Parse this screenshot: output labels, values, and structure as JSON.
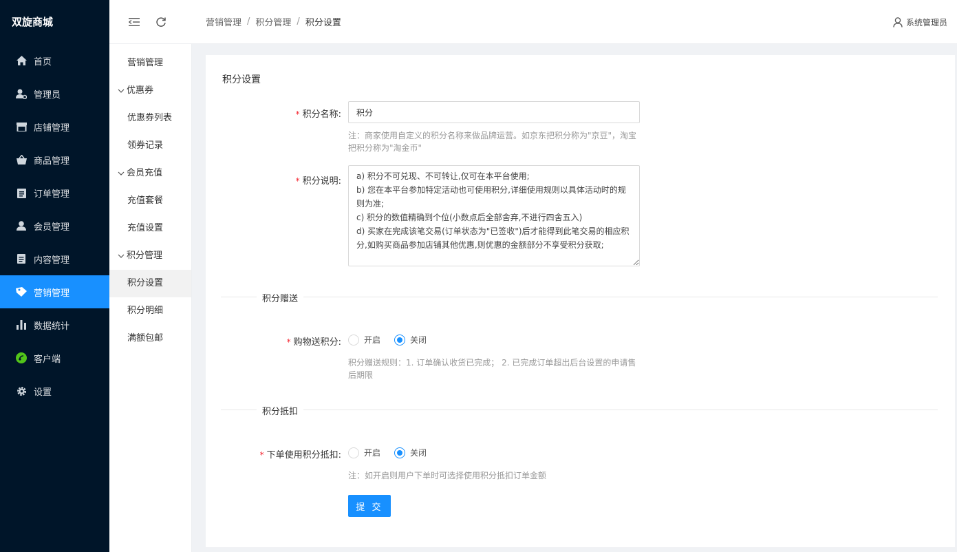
{
  "brand": "双旋商城",
  "sidebar": {
    "items": [
      {
        "label": "首页",
        "icon": "home-icon"
      },
      {
        "label": "管理员",
        "icon": "admin-user-icon"
      },
      {
        "label": "店铺管理",
        "icon": "store-icon"
      },
      {
        "label": "商品管理",
        "icon": "basket-icon"
      },
      {
        "label": "订单管理",
        "icon": "clipboard-icon"
      },
      {
        "label": "会员管理",
        "icon": "member-icon"
      },
      {
        "label": "内容管理",
        "icon": "document-icon"
      },
      {
        "label": "营销管理",
        "icon": "tag-icon"
      },
      {
        "label": "数据统计",
        "icon": "bar-chart-icon"
      },
      {
        "label": "客户端",
        "icon": "client-icon"
      },
      {
        "label": "设置",
        "icon": "gear-icon"
      }
    ],
    "active_index": 7,
    "active_color": "#1890ff",
    "background": "#001529"
  },
  "header": {
    "breadcrumb": [
      "营销管理",
      "积分管理",
      "积分设置"
    ],
    "user": "系统管理员"
  },
  "submenu": {
    "top": "营销管理",
    "group_coupon": "优惠券",
    "coupon_list": "优惠券列表",
    "coupon_records": "领券记录",
    "group_recharge": "会员充值",
    "recharge_package": "充值套餐",
    "recharge_settings": "充值设置",
    "group_points": "积分管理",
    "points_settings": "积分设置",
    "points_detail": "积分明细",
    "free_shipping": "满额包邮"
  },
  "form": {
    "title": "积分设置",
    "name_label": "积分名称:",
    "name_value": "积分",
    "name_hint": "注：商家使用自定义的积分名称来做品牌运营。如京东把积分称为\"京豆\"，淘宝把积分称为\"淘金币\"",
    "desc_label": "积分说明:",
    "desc_value": "a) 积分不可兑现、不可转让,仅可在本平台使用;\nb) 您在本平台参加特定活动也可使用积分,详细使用规则以具体活动时的规则为准;\nc) 积分的数值精确到个位(小数点后全部舍弃,不进行四舍五入)\nd) 买家在完成该笔交易(订单状态为\"已签收\")后才能得到此笔交易的相应积分,如购买商品参加店铺其他优惠,则优惠的金额部分不享受积分获取;",
    "gift_section": "积分赠送",
    "gift_label": "购物送积分:",
    "option_on": "开启",
    "option_off": "关闭",
    "gift_selected": "关闭",
    "gift_hint": "积分赠送规则：1. 订单确认收货已完成； 2. 已完成订单超出后台设置的申请售后期限",
    "deduct_section": "积分抵扣",
    "deduct_label": "下单使用积分抵扣:",
    "deduct_selected": "关闭",
    "deduct_hint": "注：如开启则用户下单时可选择使用积分抵扣订单金额",
    "submit": "提 交"
  }
}
